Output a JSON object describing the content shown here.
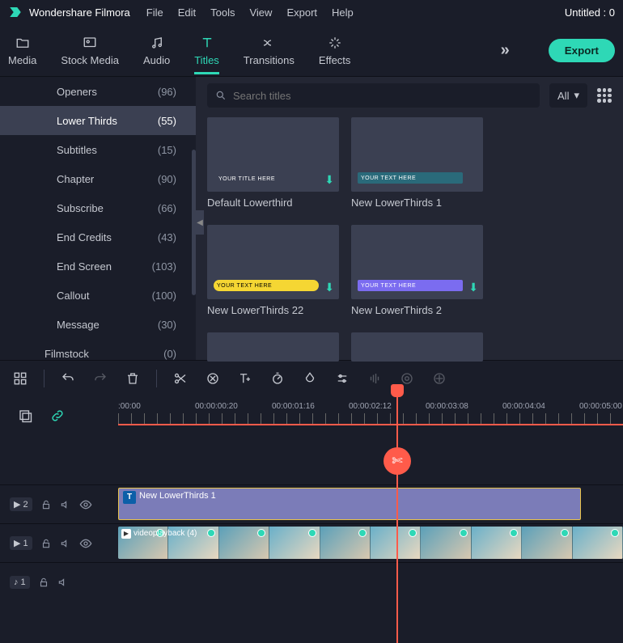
{
  "app": {
    "name": "Wondershare Filmora",
    "project": "Untitled : 0"
  },
  "menu": [
    "File",
    "Edit",
    "Tools",
    "View",
    "Export",
    "Help"
  ],
  "tabs": [
    {
      "label": "Media"
    },
    {
      "label": "Stock Media"
    },
    {
      "label": "Audio"
    },
    {
      "label": "Titles"
    },
    {
      "label": "Transitions"
    },
    {
      "label": "Effects"
    }
  ],
  "export_label": "Export",
  "sidebar": {
    "categories": [
      {
        "name": "Openers",
        "count": "(96)"
      },
      {
        "name": "Lower Thirds",
        "count": "(55)"
      },
      {
        "name": "Subtitles",
        "count": "(15)"
      },
      {
        "name": "Chapter",
        "count": "(90)"
      },
      {
        "name": "Subscribe",
        "count": "(66)"
      },
      {
        "name": "End Credits",
        "count": "(43)"
      },
      {
        "name": "End Screen",
        "count": "(103)"
      },
      {
        "name": "Callout",
        "count": "(100)"
      },
      {
        "name": "Message",
        "count": "(30)"
      },
      {
        "name": "Filmstock",
        "count": "(0)"
      }
    ]
  },
  "search": {
    "placeholder": "Search titles"
  },
  "filter": {
    "label": "All"
  },
  "thumbs": [
    {
      "caption": "Default Lowerthird",
      "sample": "YOUR TITLE HERE",
      "bg": "transparent",
      "color": "#fff"
    },
    {
      "caption": "New LowerThirds 1",
      "sample": "YOUR TEXT HERE",
      "bg": "#2a6a7a",
      "color": "#fff"
    },
    {
      "caption": "New LowerThirds 22",
      "sample": "YOUR TEXT HERE",
      "bg": "#f5d633",
      "color": "#000"
    },
    {
      "caption": "New LowerThirds 2",
      "sample": "YOUR TEXT HERE",
      "bg": "#7b6cf0",
      "color": "#fff"
    }
  ],
  "timecodes": [
    ":00:00",
    "00:00:00:20",
    "00:00:01:16",
    "00:00:02:12",
    "00:00:03:08",
    "00:00:04:04",
    "00:00:05:00"
  ],
  "tracks": {
    "t2": {
      "label": "2",
      "clip_label": "New LowerThirds 1"
    },
    "t1": {
      "label": "1",
      "clip_label": "videoplayback (4)"
    },
    "a1": {
      "label": "1"
    }
  }
}
